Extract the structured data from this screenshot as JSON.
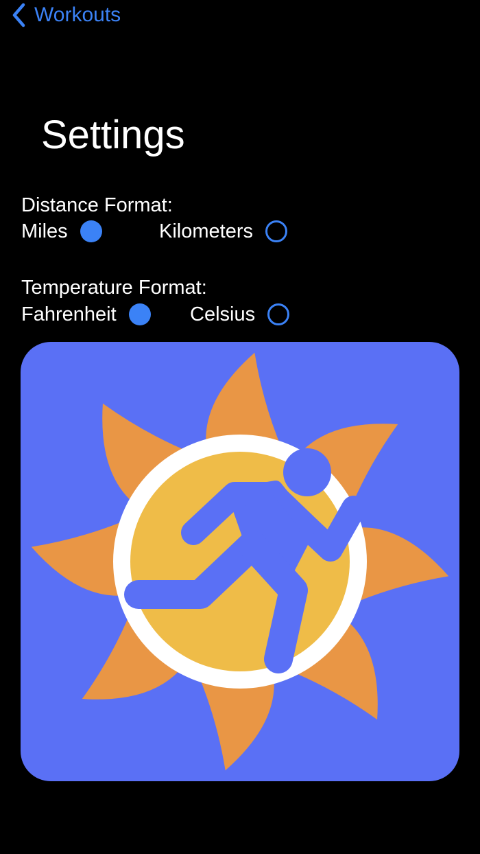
{
  "nav": {
    "back_label": "Workouts",
    "back_icon": "chevron-left-icon"
  },
  "page": {
    "title": "Settings"
  },
  "distance": {
    "label": "Distance Format:",
    "options": [
      {
        "label": "Miles",
        "selected": true
      },
      {
        "label": "Kilometers",
        "selected": false
      }
    ]
  },
  "temperature": {
    "label": "Temperature Format:",
    "options": [
      {
        "label": "Fahrenheit",
        "selected": true
      },
      {
        "label": "Celsius",
        "selected": false
      }
    ]
  },
  "logo": {
    "icon": "sun-runner-logo",
    "colors": {
      "background": "#5a70f5",
      "rays": "#e99645",
      "sun": "#efbc48",
      "ring": "#ffffff",
      "runner": "#5a70f5"
    }
  },
  "colors": {
    "accent": "#3b82f6",
    "background": "#000000",
    "text": "#ffffff"
  }
}
